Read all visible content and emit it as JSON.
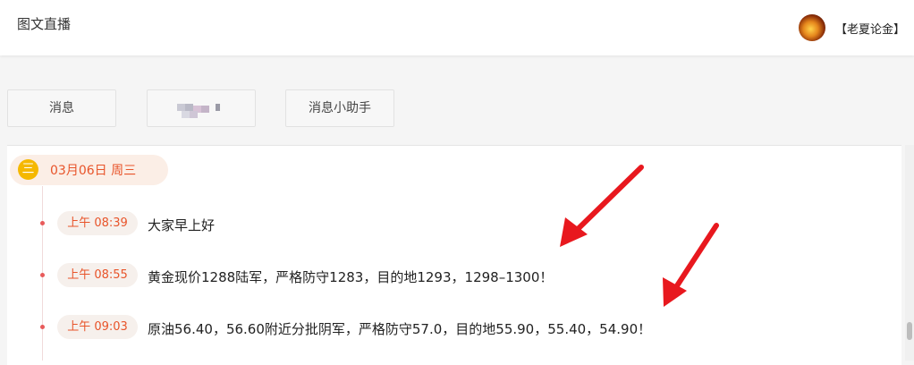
{
  "header": {
    "title": "图文直播",
    "user_name": "【老夏论金】"
  },
  "tabs": [
    {
      "label": "消息"
    },
    {
      "label": ""
    },
    {
      "label": "消息小助手"
    }
  ],
  "feed": {
    "date_label": "03月06日 周三",
    "date_icon": "三",
    "messages": [
      {
        "time": "上午 08:39",
        "text": "大家早上好"
      },
      {
        "time": "上午 08:55",
        "text": "黄金现价1288陆军，严格防守1283，目的地1293，1298–1300！"
      },
      {
        "time": "上午 09:03",
        "text": "原油56.40，56.60附近分批阴军，严格防守57.0，目的地55.90，55.40，54.90！"
      }
    ]
  },
  "colors": {
    "accent": "#e8542a",
    "arrow": "#e8181e",
    "date_icon_bg": "#f5b800"
  }
}
